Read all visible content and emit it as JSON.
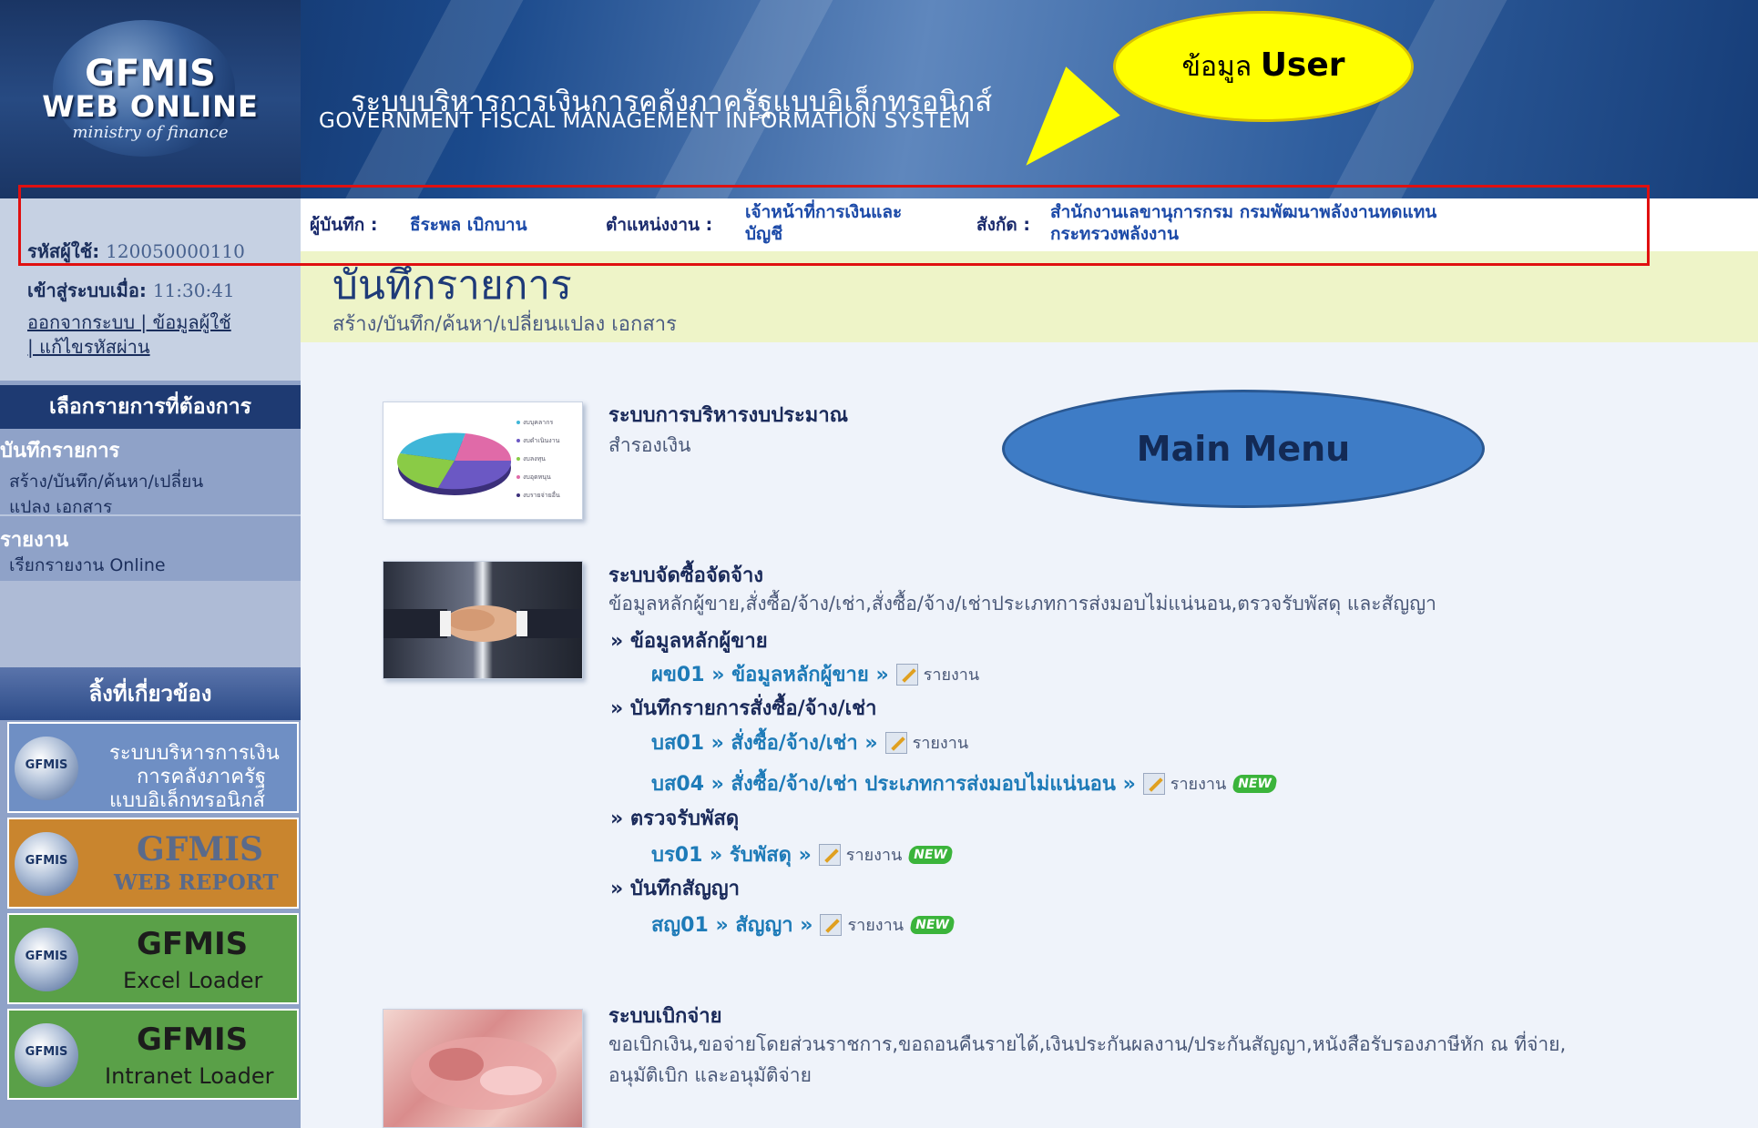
{
  "header": {
    "logo_line1": "GFMIS",
    "logo_line2": "WEB ONLINE",
    "logo_line3": "ministry of finance",
    "system_title_th": "ระบบบริหารการเงินการคลังภาครัฐแบบอิเล็กทรอนิกส์",
    "system_title_en": "GOVERNMENT FISCAL MANAGEMENT INFORMATION SYSTEM"
  },
  "callouts": {
    "user_info_prefix": "ข้อมูล",
    "user_info_bold": "User",
    "main_menu": "Main Menu"
  },
  "user_bar": {
    "recorder_label": "ผู้บันทึก :",
    "recorder_value": "ธีระพล เบิกบาน",
    "position_label": "ตำแหน่งงาน :",
    "position_value_1": "เจ้าหน้าที่การเงินและ",
    "position_value_2": "บัญชี",
    "affiliation_label": "สังกัด :",
    "affiliation_value_1": "สำนักงานเลขานุการกรม กรมพัฒนาพลังงานทดแทน",
    "affiliation_value_2": "กระทรวงพลังงาน"
  },
  "sidebar": {
    "user_code_label": "รหัสผู้ใช้:",
    "user_code_value": "120050000110",
    "login_time_label": "เข้าสู่ระบบเมื่อ:",
    "login_time_value": "11:30:41",
    "links_line1": "ออกจากระบบ | ข้อมูลผู้ใช้",
    "links_line2": "| แก้ไขรหัสผ่าน",
    "select_header": "เลือกรายการที่ต้องการ",
    "menu": [
      {
        "title": "บันทึกรายการ",
        "sub1": "สร้าง/บันทึก/ค้นหา/เปลี่ยน",
        "sub2": "แปลง เอกสาร"
      },
      {
        "title": "รายงาน",
        "sub1": "เรียกรายงาน Online",
        "sub2": ""
      }
    ],
    "related_links_header": "ลิ้งที่เกี่ยวข้อง",
    "banners": [
      {
        "globe": "GFMIS",
        "line1": "ระบบบริหารการเงิน",
        "line2": "การคลังภาครัฐ",
        "line3": "แบบอิเล็กทรอนิกส์",
        "bg": "#6f8fc4"
      },
      {
        "globe": "GFMIS",
        "line1": "GFMIS",
        "line2": "WEB REPORT",
        "bg": "#c9852e"
      },
      {
        "globe": "GFMIS",
        "line1": "GFMIS",
        "line2": "Excel Loader",
        "bg": "#5aa048"
      },
      {
        "globe": "GFMIS",
        "line1": "GFMIS",
        "line2": "Intranet Loader",
        "bg": "#5aa048"
      }
    ]
  },
  "main": {
    "page_title": "บันทึกรายการ",
    "page_subtitle": "สร้าง/บันทึก/ค้นหา/เปลี่ยนแปลง เอกสาร",
    "sections": {
      "budget": {
        "title": "ระบบการบริหารงบประมาณ",
        "desc": "สำรองเงิน"
      },
      "procurement": {
        "title": "ระบบจัดซื้อจัดจ้าง",
        "desc": "ข้อมูลหลักผู้ขาย,สั่งซื้อ/จ้าง/เช่า,สั่งซื้อ/จ้าง/เช่าประเภทการส่งมอบไม่แน่นอน,ตรวจรับพัสดุ และสัญญา",
        "groups": [
          {
            "head": "» ข้อมูลหลักผู้ขาย",
            "items": [
              {
                "code": "ผข01 » ข้อมูลหลักผู้ขาย »",
                "report": "รายงาน",
                "new": ""
              }
            ]
          },
          {
            "head": "» บันทึกรายการสั่งซื้อ/จ้าง/เช่า",
            "items": [
              {
                "code": "บส01 » สั่งซื้อ/จ้าง/เช่า »",
                "report": "รายงาน",
                "new": ""
              },
              {
                "code": "บส04 » สั่งซื้อ/จ้าง/เช่า ประเภทการส่งมอบไม่แน่นอน »",
                "report": "รายงาน",
                "new": "NEW"
              }
            ]
          },
          {
            "head": "» ตรวจรับพัสดุ",
            "items": [
              {
                "code": "บร01 » รับพัสดุ »",
                "report": "รายงาน",
                "new": "NEW"
              }
            ]
          },
          {
            "head": "» บันทึกสัญญา",
            "items": [
              {
                "code": "สญ01 » สัญญา »",
                "report": "รายงาน",
                "new": "NEW"
              }
            ]
          }
        ]
      },
      "disbursement": {
        "title": "ระบบเบิกจ่าย",
        "desc1": "ขอเบิกเงิน,ขอจ่ายโดยส่วนราชการ,ขอถอนคืนรายได้,เงินประกันผลงาน/ประกันสัญญา,หนังสือรับรองภาษีหัก ณ ที่จ่าย,",
        "desc2": "อนุมัติเบิก และอนุมัติจ่าย"
      }
    },
    "pie_legend": [
      "งบบุคลากร",
      "งบดำเนินงาน",
      "งบลงทุน",
      "งบอุดหนุน",
      "งบรายจ่ายอื่น"
    ]
  }
}
